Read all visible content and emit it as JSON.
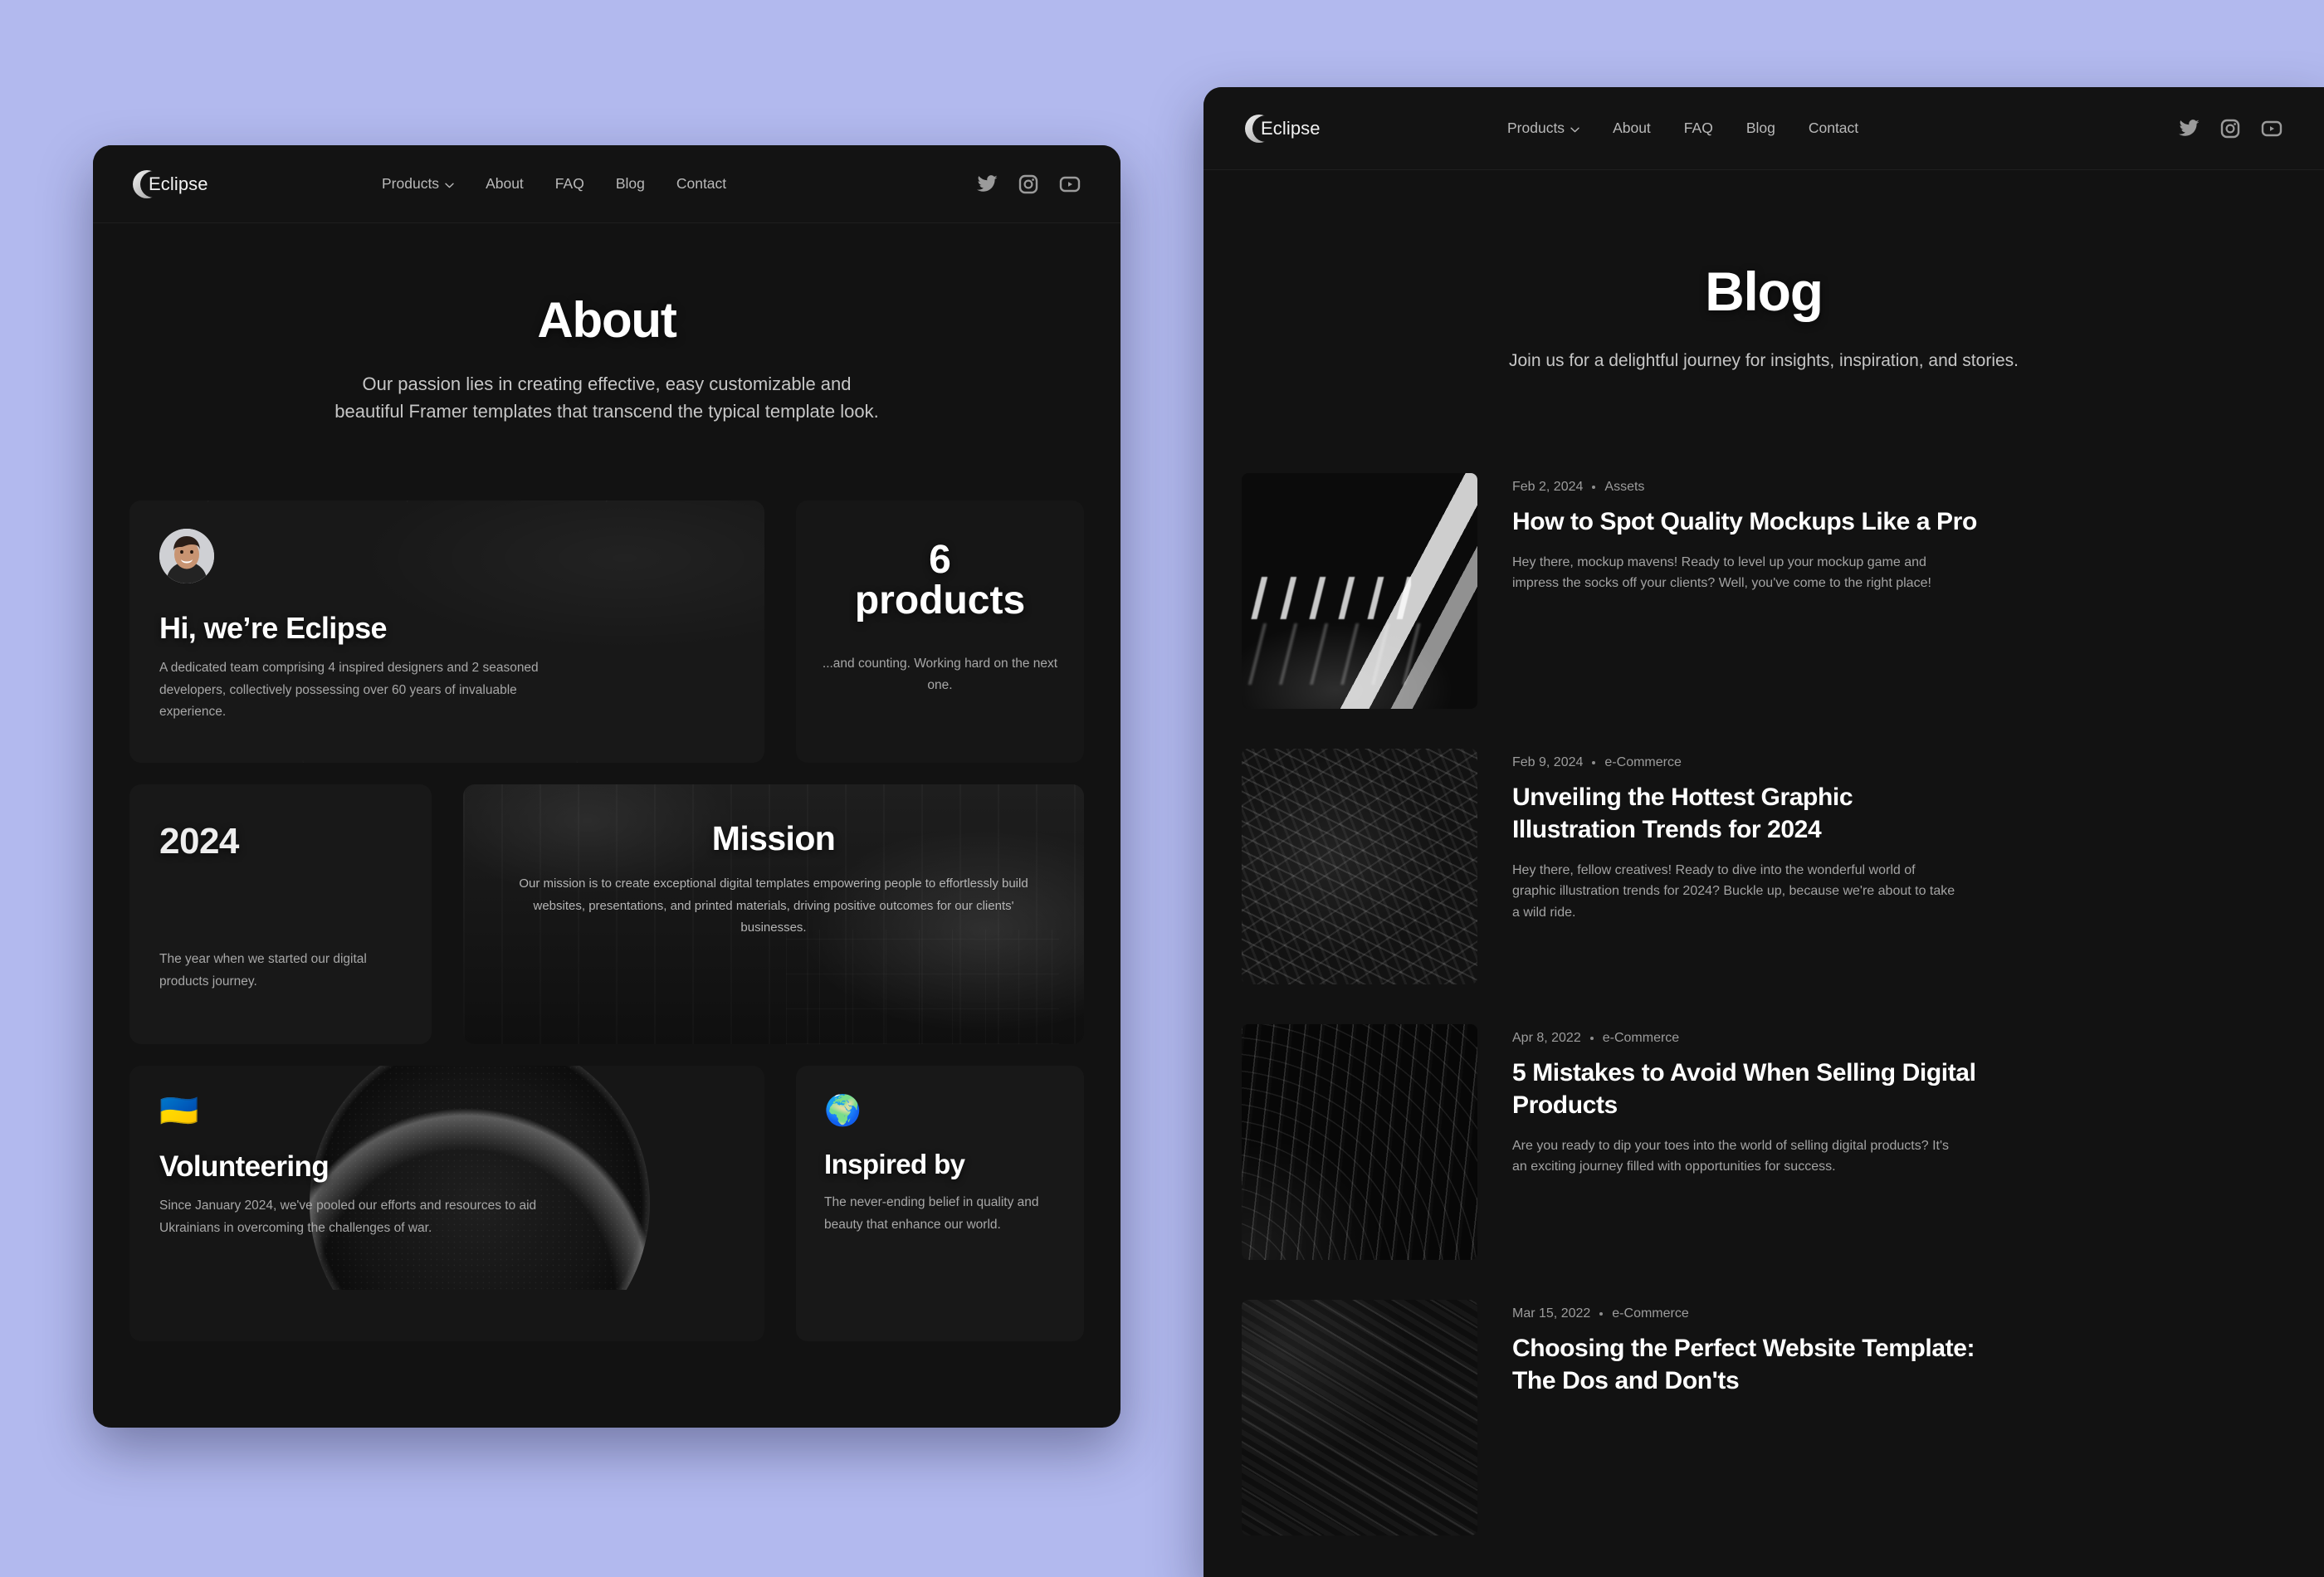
{
  "page": {
    "background_color": "#b2b9ee",
    "card_background": "#121212"
  },
  "brand": {
    "name": "Eclipse",
    "logo_icon": "eclipse-crescent-icon"
  },
  "nav": {
    "links": [
      {
        "label": "Products",
        "has_dropdown": true
      },
      {
        "label": "About",
        "has_dropdown": false
      },
      {
        "label": "FAQ",
        "has_dropdown": false
      },
      {
        "label": "Blog",
        "has_dropdown": false
      },
      {
        "label": "Contact",
        "has_dropdown": false
      }
    ],
    "social": [
      {
        "name": "twitter-icon",
        "label": "Twitter"
      },
      {
        "name": "instagram-icon",
        "label": "Instagram"
      },
      {
        "name": "youtube-icon",
        "label": "YouTube"
      }
    ]
  },
  "about": {
    "hero": {
      "title": "About",
      "subtitle": "Our passion lies in creating effective, easy customizable and beautiful Framer templates that transcend the typical template look."
    },
    "cards": {
      "team": {
        "avatar_alt": "team-member-portrait",
        "heading": "Hi, we’re Eclipse",
        "body": "A dedicated team comprising 4 inspired designers and 2 seasoned developers, collectively possessing over 60 years of invaluable experience."
      },
      "products": {
        "count": "6",
        "unit": "products",
        "body": "...and counting. Working hard on the next one."
      },
      "year": {
        "value": "2024",
        "body": "The year when we started our digital products journey."
      },
      "mission": {
        "heading": "Mission",
        "body": "Our mission is to create exceptional digital templates empowering people to effortlessly build websites, presentations, and printed materials, driving positive outcomes for our clients' businesses."
      },
      "volunteering": {
        "emoji": "🇺🇦",
        "heading": "Volunteering",
        "body": "Since January 2024, we've pooled our efforts and resources to aid Ukrainians in overcoming the challenges of war."
      },
      "inspired": {
        "emoji": "🌍",
        "heading": "Inspired by",
        "body": "The never-ending belief in quality and beauty that enhance our world."
      }
    }
  },
  "blog": {
    "hero": {
      "title": "Blog",
      "subtitle": "Join us for a delightful journey for insights, inspiration, and stories."
    },
    "posts": [
      {
        "date": "Feb 2, 2024",
        "category": "Assets",
        "title": "How to Spot Quality Mockups Like a Pro",
        "excerpt": "Hey there, mockup mavens! Ready to level up your mockup game and impress the socks off your clients? Well, you've come to the right place!",
        "thumbnail": "dark-corridor-light-slits"
      },
      {
        "date": "Feb 9, 2024",
        "category": "e-Commerce",
        "title": "Unveiling the Hottest Graphic Illustration Trends for 2024",
        "excerpt": "Hey there, fellow creatives! Ready to dive into the wonderful world of graphic illustration trends for 2024? Buckle up, because we're about to take a wild ride.",
        "thumbnail": "dark-rock-texture"
      },
      {
        "date": "Apr 8, 2022",
        "category": "e-Commerce",
        "title": "5 Mistakes to Avoid When Selling Digital Products",
        "excerpt": "Are you ready to dip your toes into the world of selling digital products? It's an exciting journey filled with opportunities for success.",
        "thumbnail": "dark-curved-ribs"
      },
      {
        "date": "Mar 15, 2022",
        "category": "e-Commerce",
        "title": "Choosing the Perfect Website Template: The Dos and Don'ts",
        "excerpt": "",
        "thumbnail": "dark-sand-dunes"
      }
    ]
  }
}
